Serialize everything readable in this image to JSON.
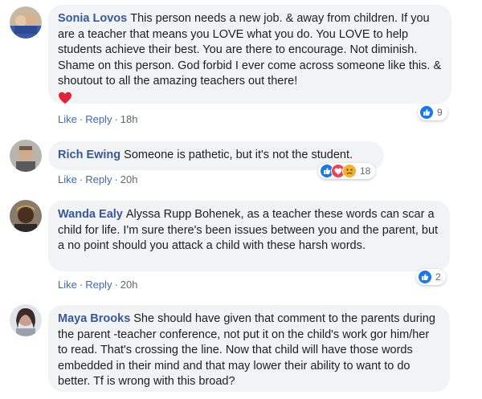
{
  "comments": [
    {
      "author": "Sonia Lovos",
      "text": "This person needs a new job. & away from children. If you are a teacher that means you LOVE what you do. You LOVE to help students achieve their best. You are there to encourage. Not diminish. Shame on this person. God forbid I ever come across someone like this. & shoutout to all the amazing teachers out there!",
      "emoji": "heart",
      "like_label": "Like",
      "reply_label": "Reply",
      "time": "18h",
      "reaction_count": "9",
      "reactions": [
        "like"
      ]
    },
    {
      "author": "Rich Ewing",
      "text": "Someone is pathetic, but it's not the student.",
      "like_label": "Like",
      "reply_label": "Reply",
      "time": "20h",
      "reaction_count": "18",
      "reactions": [
        "like",
        "love",
        "sad"
      ]
    },
    {
      "author": "Wanda Ealy",
      "text": "Alyssa Rupp Bohenek, as a teacher these words can scar a child for life. I'm sure there's been issues between you and the parent, but a no point should you attack a child with these harsh words.",
      "like_label": "Like",
      "reply_label": "Reply",
      "time": "20h",
      "reaction_count": "2",
      "reactions": [
        "like"
      ]
    },
    {
      "author": "Maya Brooks",
      "text": "She should have given that comment to the parents during the parent -teacher conference, not put it on the child's work gor him/her to read. That's crossing the line. Now that child will have those words embedded in their mind and that may lower their ability to want to do better. Tf is wrong with this broad?"
    }
  ],
  "colors": {
    "bubble": "#f2f3f5",
    "author": "#385898",
    "link": "#4267b2",
    "like": "#1877f2",
    "love": "#f33e58",
    "sad": "#f7b125"
  }
}
